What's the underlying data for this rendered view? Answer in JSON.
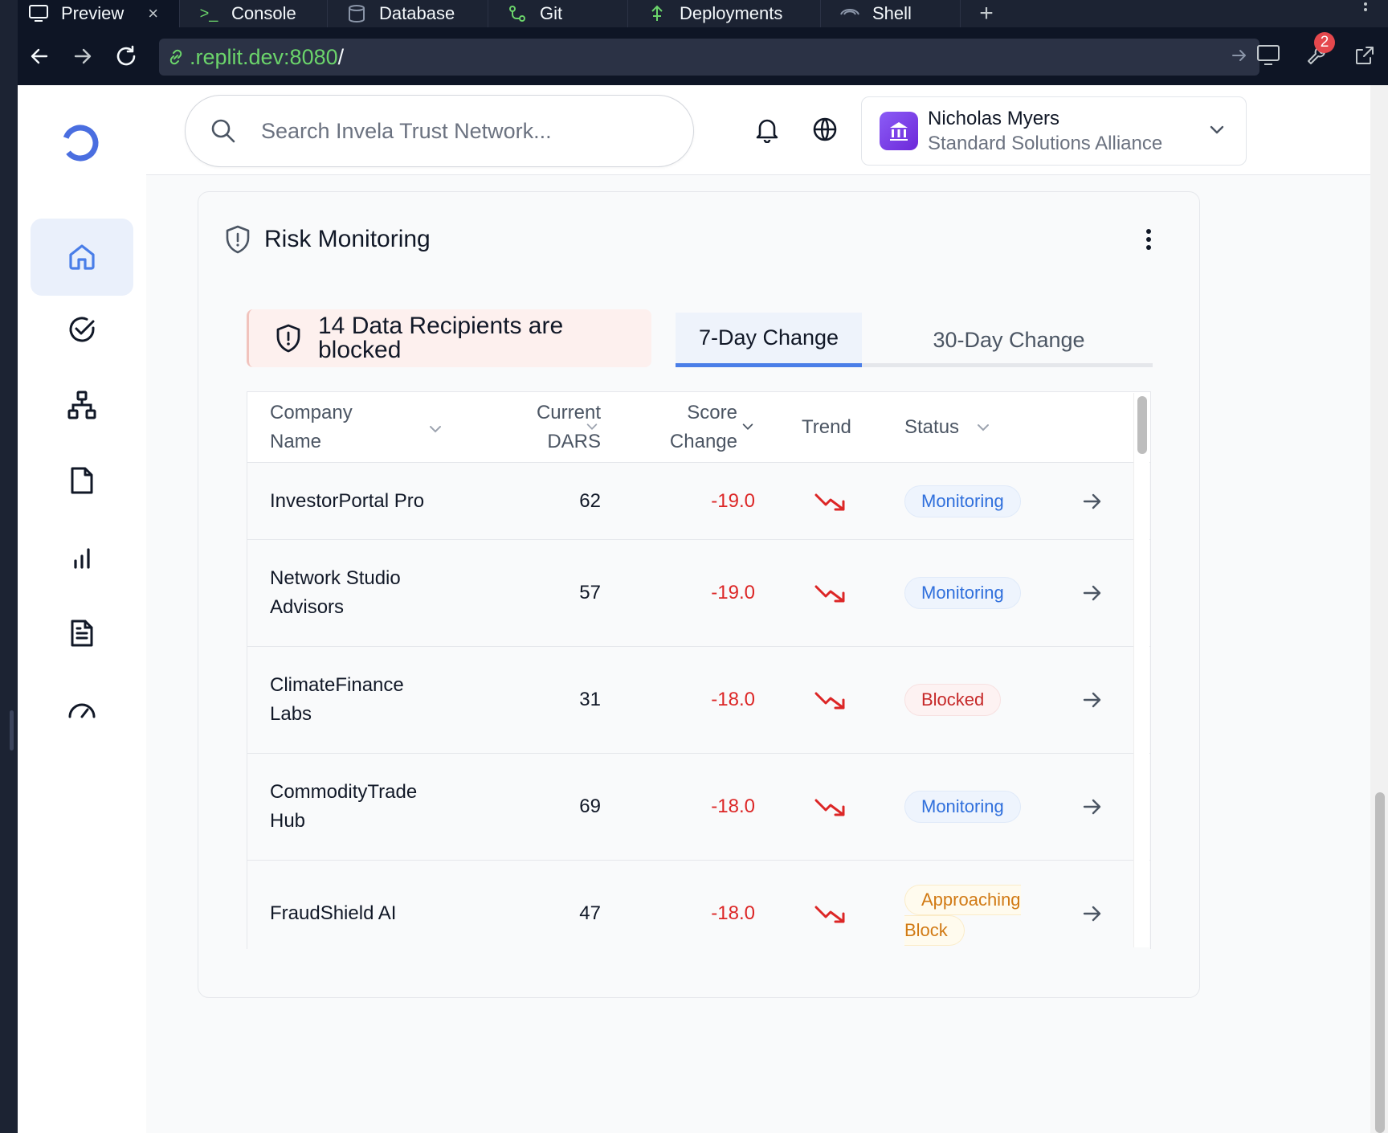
{
  "browser": {
    "tabs": [
      {
        "label": "Preview",
        "active": true
      },
      {
        "label": "Console"
      },
      {
        "label": "Database"
      },
      {
        "label": "Git"
      },
      {
        "label": "Deployments"
      },
      {
        "label": "Shell"
      }
    ],
    "url_host": ".replit.dev:8080",
    "url_path": "/",
    "notification_count": "2"
  },
  "header": {
    "search_placeholder": "Search Invela Trust Network...",
    "user_name": "Nicholas Myers",
    "user_org": "Standard Solutions Alliance"
  },
  "sidebar": {
    "items": [
      {
        "icon": "home-icon",
        "active": true
      },
      {
        "icon": "check-circle-icon"
      },
      {
        "icon": "network-icon"
      },
      {
        "icon": "file-icon"
      },
      {
        "icon": "bar-chart-icon"
      },
      {
        "icon": "document-text-icon"
      },
      {
        "icon": "gauge-icon"
      }
    ]
  },
  "card": {
    "title": "Risk Monitoring",
    "blocked_banner": "14 Data Recipients are blocked",
    "tabs": [
      {
        "label": "7-Day Change",
        "active": true
      },
      {
        "label": "30-Day Change"
      }
    ],
    "columns": {
      "company": "Company Name",
      "dars": "Current DARS",
      "change": "Score Change",
      "trend": "Trend",
      "status": "Status"
    },
    "rows": [
      {
        "company": "InvestorPortal Pro",
        "dars": "62",
        "change": "-19.0",
        "status": "Monitoring"
      },
      {
        "company": "Network Studio Advisors",
        "dars": "57",
        "change": "-19.0",
        "status": "Monitoring"
      },
      {
        "company": "ClimateFinance Labs",
        "dars": "31",
        "change": "-18.0",
        "status": "Blocked"
      },
      {
        "company": "CommodityTrade Hub",
        "dars": "69",
        "change": "-18.0",
        "status": "Monitoring"
      },
      {
        "company": "FraudShield AI",
        "dars": "47",
        "change": "-18.0",
        "status_line1": "Approaching",
        "status_line2": "Block"
      }
    ]
  },
  "colors": {
    "accent": "#4a7ee8",
    "negative": "#dc2626",
    "monitoring": "#2f6fdc",
    "blocked": "#c62828",
    "approaching": "#d17a14"
  }
}
